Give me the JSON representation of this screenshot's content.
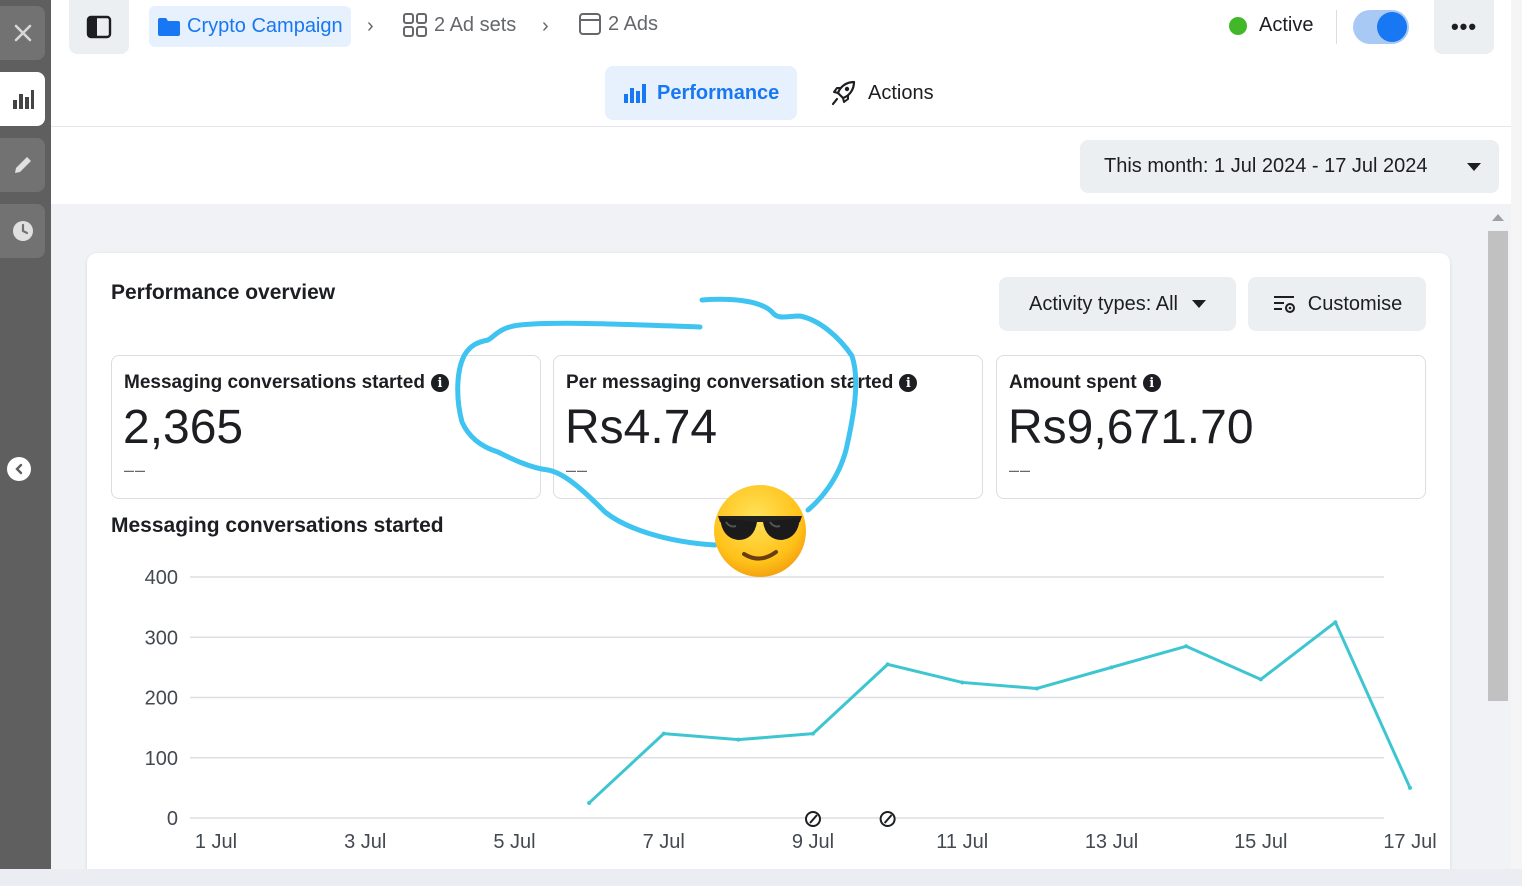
{
  "topbar": {
    "breadcrumb": {
      "campaign": "Crypto Campaign",
      "ad_sets": "2 Ad sets",
      "ads": "2 Ads"
    },
    "status_label": "Active",
    "toggle_on": true,
    "more_label": "•••"
  },
  "tabs": [
    {
      "label": "Performance",
      "active": true
    },
    {
      "label": "Actions",
      "active": false
    }
  ],
  "date_range": "This month: 1 Jul 2024 - 17 Jul 2024",
  "overview": {
    "title": "Performance overview",
    "activity_filter": "Activity types: All",
    "customise_label": "Customise",
    "metrics": [
      {
        "label": "Messaging conversations started",
        "value": "2,365",
        "comparison": "––"
      },
      {
        "label": "Per messaging conversation started",
        "value": "Rs4.74",
        "comparison": "––"
      },
      {
        "label": "Amount spent",
        "value": "Rs9,671.70",
        "comparison": "––"
      }
    ]
  },
  "colors": {
    "accent": "#1877f2",
    "status_green": "#42b72a",
    "chart_line": "#3ec6d0",
    "annotation": "#3fc3f0"
  },
  "chart_data": {
    "type": "line",
    "title": "Messaging conversations started",
    "xlabel": "",
    "ylabel": "",
    "x_ticks": [
      "1 Jul",
      "3 Jul",
      "5 Jul",
      "7 Jul",
      "9 Jul",
      "11 Jul",
      "13 Jul",
      "15 Jul",
      "17 Jul"
    ],
    "y_ticks": [
      0,
      100,
      200,
      300,
      400
    ],
    "ylim": [
      0,
      400
    ],
    "grid": true,
    "series": [
      {
        "x": [
          1,
          2,
          3,
          4,
          5,
          6,
          7,
          8,
          9,
          10,
          11,
          12,
          13,
          14,
          15,
          16,
          17
        ],
        "values": [
          null,
          null,
          null,
          null,
          null,
          25,
          140,
          130,
          140,
          255,
          225,
          215,
          250,
          285,
          230,
          325,
          50
        ]
      }
    ]
  }
}
